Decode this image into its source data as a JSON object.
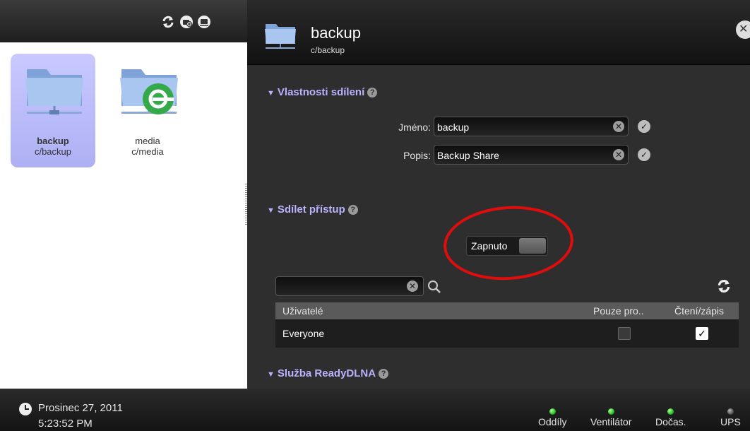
{
  "colors": {
    "accent_text": "#b9b3ff",
    "selected_item_bg": "#aeb0f4",
    "annotation_circle": "#e10d0d",
    "status_ok": "#20c020",
    "status_off": "#555555"
  },
  "toolbar": {
    "icons": [
      "refresh-icon",
      "add-share-icon",
      "share-settings-icon"
    ]
  },
  "shares": [
    {
      "name": "backup",
      "path": "c/backup",
      "selected": true,
      "icon": "network-folder-icon"
    },
    {
      "name": "media",
      "path": "c/media",
      "selected": false,
      "icon": "media-network-folder-icon"
    }
  ],
  "detail": {
    "title": "backup",
    "subtitle": "c/backup",
    "close_icon": "close-icon",
    "sections": {
      "properties": {
        "title": "Vlastnosti sdílení",
        "name_label": "Jméno:",
        "name_value": "backup",
        "description_label": "Popis:",
        "description_value": "Backup Share"
      },
      "access": {
        "title": "Sdílet přístup",
        "toggle_label": "Zapnuto",
        "search_value": "",
        "columns": [
          "Uživatelé",
          "Pouze pro..",
          "Čtení/zápis"
        ],
        "rows": [
          {
            "user": "Everyone",
            "read_only": false,
            "read_write": true
          }
        ]
      },
      "dlna": {
        "title": "Služba ReadyDLNA"
      }
    }
  },
  "status": {
    "date": "Prosinec 27, 2011",
    "time": "5:23:52 PM",
    "indicators": [
      {
        "label": "Oddíly",
        "state": "green"
      },
      {
        "label": "Ventilátor",
        "state": "green"
      },
      {
        "label": "Dočas.",
        "state": "green"
      },
      {
        "label": "UPS",
        "state": "gray"
      }
    ]
  }
}
